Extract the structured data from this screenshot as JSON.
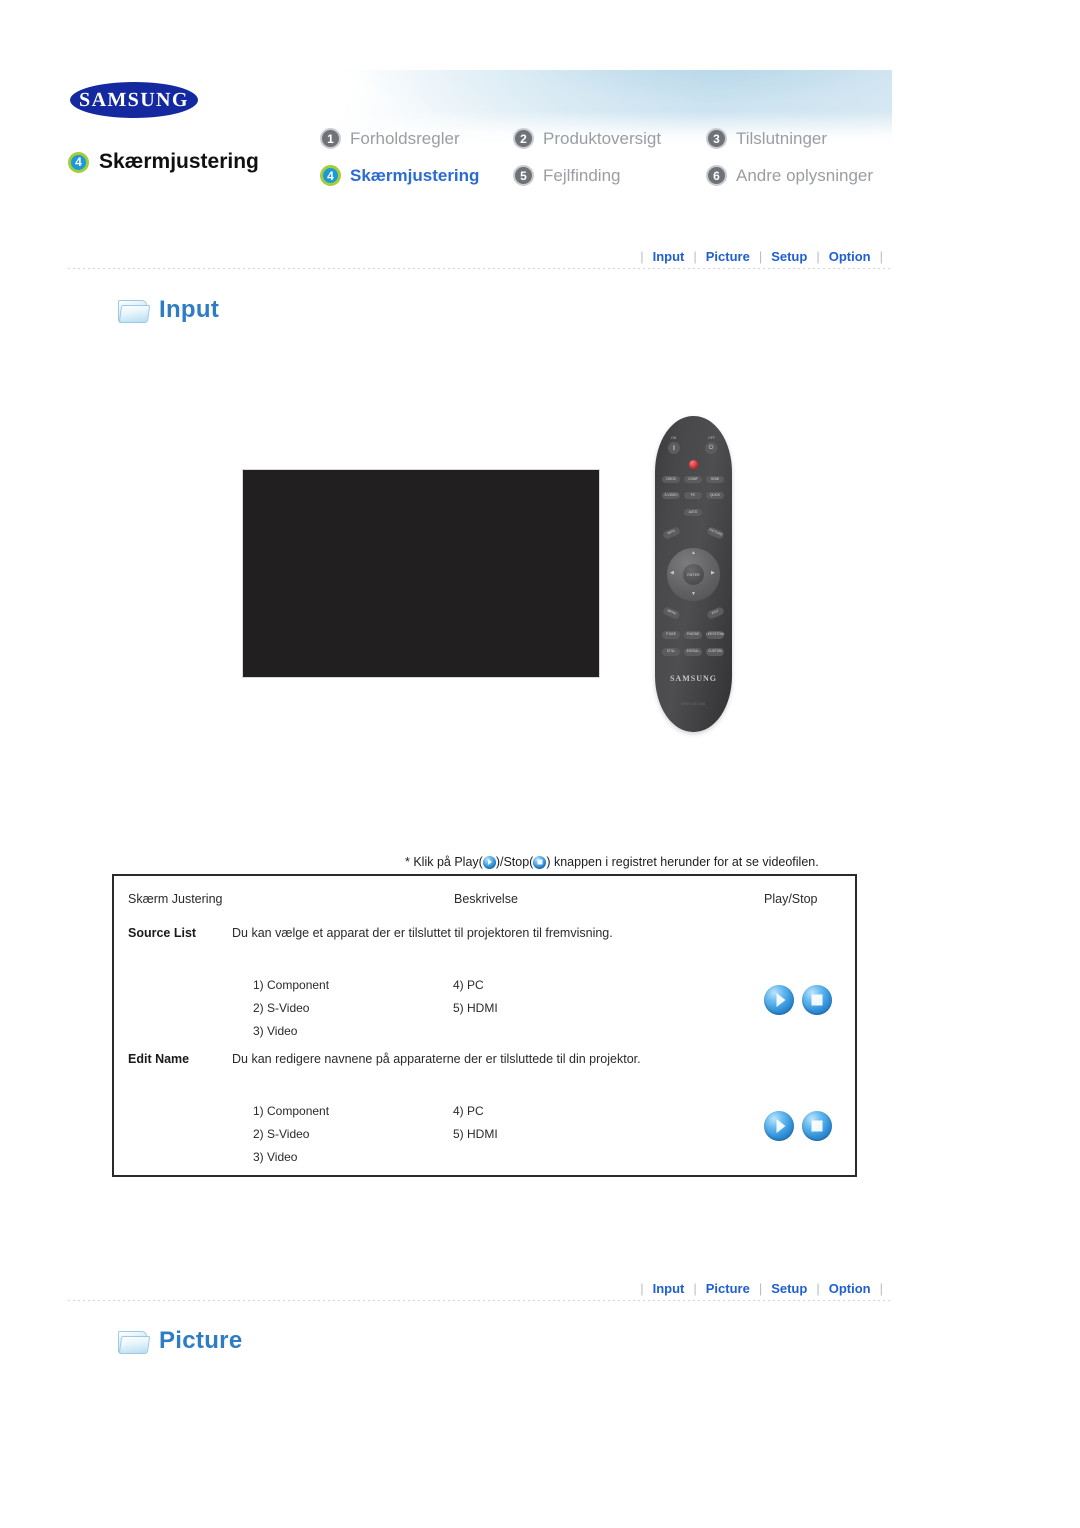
{
  "brand": {
    "logo_text": "SAMSUNG"
  },
  "header": {
    "page_badge_number": "4",
    "page_title": "Skærmjustering",
    "nav_items": [
      {
        "number": "1",
        "label": "Forholdsregler",
        "current": false
      },
      {
        "number": "2",
        "label": "Produktoversigt",
        "current": false
      },
      {
        "number": "3",
        "label": "Tilslutninger",
        "current": false
      },
      {
        "number": "4",
        "label": "Skærmjustering",
        "current": true
      },
      {
        "number": "5",
        "label": "Fejlfinding",
        "current": false
      },
      {
        "number": "6",
        "label": "Andre oplysninger",
        "current": false
      }
    ]
  },
  "tabbar": {
    "separator": "|",
    "tabs": [
      {
        "label": "Input"
      },
      {
        "label": "Picture"
      },
      {
        "label": "Setup"
      },
      {
        "label": "Option"
      }
    ]
  },
  "sections": [
    {
      "icon": "folder-icon",
      "title": "Input"
    },
    {
      "icon": "folder-icon",
      "title": "Picture"
    }
  ],
  "media": {
    "video_placeholder": "",
    "remote": {
      "brand": "SAMSUNG",
      "model": "BP59-00144A",
      "label_on": "ON",
      "label_off": "OFF",
      "power_on_glyph": "❙",
      "power_off_glyph": "⏻",
      "buttons": [
        "CMOS",
        "COMP",
        "HDMI",
        "S-VIDEO",
        "PC",
        "QUICK",
        "AUTO",
        "INFO",
        "PICTURE",
        "MENU",
        "EXIT",
        "P.SIZE",
        "P.MODE",
        "V.KEYSTONE",
        "STILL",
        "INSTALL",
        "CUSTOM"
      ],
      "enter_label": "ENTER",
      "arrow_up": "▲",
      "arrow_down": "▼",
      "arrow_left": "◀",
      "arrow_right": "▶"
    }
  },
  "caption": {
    "prefix": "* Klik på Play(",
    "middle": ")/Stop(",
    "suffix": ") knappen i registret herunder for at se videofilen.",
    "play_icon": "play-orb-icon",
    "stop_icon": "stop-orb-icon"
  },
  "table": {
    "columns": [
      "Skærm Justering",
      "Beskrivelse",
      "Play/Stop"
    ],
    "rows": [
      {
        "name": "Source List",
        "description": "Du kan vælge et apparat der er tilsluttet til projektoren til fremvisning.",
        "options_left": [
          "1) Component",
          "2) S-Video",
          "3) Video"
        ],
        "options_right": [
          "4) PC",
          "5) HDMI"
        ],
        "play_label": "Play",
        "stop_label": "Stop"
      },
      {
        "name": "Edit Name",
        "description": "Du kan redigere navnene på apparaterne der er tilsluttede til din projektor.",
        "options_left": [
          "1) Component",
          "2) S-Video",
          "3) Video"
        ],
        "options_right": [
          "4) PC",
          "5) HDMI"
        ],
        "play_label": "Play",
        "stop_label": "Stop"
      }
    ]
  },
  "colors": {
    "link_blue": "#1f5fd0",
    "section_blue": "#2e7cc4",
    "badge_active_fill": "#1a9ad7",
    "badge_active_ring": "#a4cd39",
    "samsung_blue": "#1428a0",
    "orb_blue": "#2f8fd8",
    "video_black": "#211f20"
  }
}
